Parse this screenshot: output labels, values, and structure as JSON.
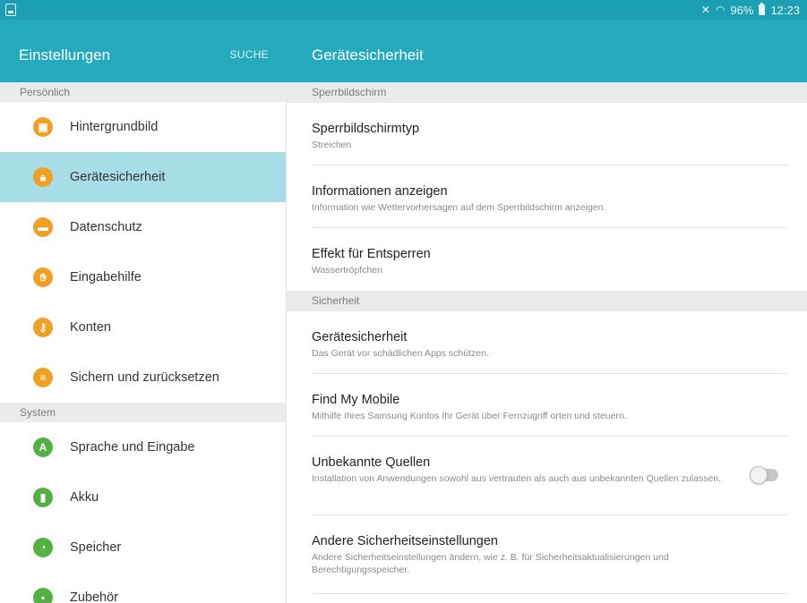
{
  "status_bar": {
    "battery_text": "96%",
    "time": "12:23",
    "icons": [
      "screenshot-icon",
      "mute-icon",
      "wifi-icon",
      "battery-icon"
    ]
  },
  "header": {
    "app_title": "Einstellungen",
    "search_label": "SUCHE",
    "page_title": "Gerätesicherheit"
  },
  "colors": {
    "header": "#25a9bd",
    "status_bar": "#1d9fb3",
    "active_item": "#a6dde6",
    "icon_orange": "#f0a022",
    "icon_green": "#55b043"
  },
  "sidebar": {
    "sections": [
      {
        "title": "Persönlich",
        "items": [
          {
            "label": "Hintergrundbild",
            "icon": "wallpaper-icon"
          },
          {
            "label": "Gerätesicherheit",
            "icon": "lock-icon",
            "active": true
          },
          {
            "label": "Datenschutz",
            "icon": "privacy-icon"
          },
          {
            "label": "Eingabehilfe",
            "icon": "hand-icon"
          },
          {
            "label": "Konten",
            "icon": "key-icon"
          },
          {
            "label": "Sichern und zurücksetzen",
            "icon": "backup-icon"
          }
        ]
      },
      {
        "title": "System",
        "items": [
          {
            "label": "Sprache und Eingabe",
            "icon": "language-icon"
          },
          {
            "label": "Akku",
            "icon": "battery-icon"
          },
          {
            "label": "Speicher",
            "icon": "storage-icon"
          },
          {
            "label": "Zubehör",
            "icon": "accessory-icon"
          }
        ]
      }
    ]
  },
  "main": {
    "sections": [
      {
        "title": "Sperrbildschirm",
        "items": [
          {
            "title": "Sperrbildschirmtyp",
            "subtitle": "Streichen"
          },
          {
            "title": "Informationen anzeigen",
            "subtitle": "Information wie Wettervorhersagen auf dem Sperrbildschirm anzeigen."
          },
          {
            "title": "Effekt für Entsperren",
            "subtitle": "Wassertröpfchen"
          }
        ]
      },
      {
        "title": "Sicherheit",
        "items": [
          {
            "title": "Gerätesicherheit",
            "subtitle": "Das Gerät vor schädlichen Apps schützen."
          },
          {
            "title": "Find My Mobile",
            "subtitle": "Mithilfe Ihres Samsung Kontos Ihr Gerät über Fernzugriff orten und steuern."
          },
          {
            "title": "Unbekannte Quellen",
            "subtitle": "Installation von Anwendungen sowohl aus vertrauten als auch aus unbekannten Quellen zulassen.",
            "toggle": false
          },
          {
            "title": "Andere Sicherheitseinstellungen",
            "subtitle": "Andere Sicherheitseinstellungen ändern, wie z. B. für Sicherheitsaktualisierungen und Berechtigungsspeicher."
          }
        ]
      }
    ]
  }
}
